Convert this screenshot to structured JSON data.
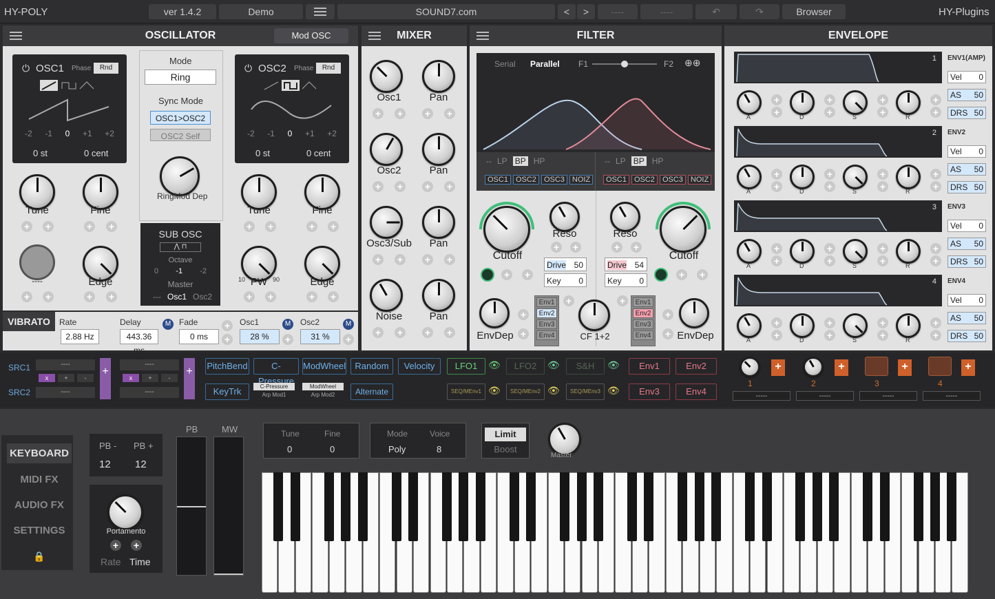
{
  "topbar": {
    "app_name": "HY-POLY",
    "version": "ver 1.4.2",
    "preset": "Demo",
    "site": "SOUND7.com",
    "prev": "<",
    "next": ">",
    "slot1": "----",
    "slot2": "----",
    "browser": "Browser",
    "brand": "HY-Plugins"
  },
  "oscillator": {
    "title": "OSCILLATOR",
    "mod_select": "Mod OSC",
    "osc1": {
      "name": "OSC1",
      "phase": "Phase",
      "rnd": "Rnd",
      "ticks": [
        "-2",
        "-1",
        "0",
        "+1",
        "+2"
      ],
      "semitone": "0 st",
      "cent": "0 cent"
    },
    "osc2": {
      "name": "OSC2",
      "phase": "Phase",
      "rnd": "Rnd",
      "ticks": [
        "-2",
        "-1",
        "0",
        "+1",
        "+2"
      ],
      "semitone": "0 st",
      "cent": "0 cent"
    },
    "mode_label": "Mode",
    "mode_value": "Ring",
    "sync_label": "Sync Mode",
    "sync_a": "OSC1>OSC2",
    "sync_b": "OSC2 Self",
    "ringmod": "RingMod Dep",
    "sub": {
      "title": "SUB OSC",
      "octave": "Octave",
      "oct_vals": [
        "0",
        "-1",
        "-2"
      ],
      "master": "Master",
      "m_vals": [
        "---",
        "Osc1",
        "Osc2"
      ]
    },
    "knobs": {
      "tune1": "Tune",
      "fine1": "Fine",
      "tune2": "Tune",
      "fine2": "Fine",
      "blank": "----",
      "edge1": "Edge",
      "pw": "PW",
      "pw_min": "10",
      "pw_max": "90",
      "edge2": "Edge"
    }
  },
  "vibrato": {
    "title": "VIBRATO",
    "rate_l": "Rate",
    "rate_v": "2.88 Hz",
    "delay_l": "Delay",
    "delay_v": "443.36 ms",
    "fade_l": "Fade",
    "fade_v": "0 ms",
    "osc1_l": "Osc1",
    "osc1_v": "28 %",
    "osc2_l": "Osc2",
    "osc2_v": "31 %",
    "m": "M"
  },
  "mixer": {
    "title": "MIXER",
    "rows": [
      {
        "src": "Osc1",
        "pan": "Pan"
      },
      {
        "src": "Osc2",
        "pan": "Pan"
      },
      {
        "src": "Osc3/Sub",
        "pan": "Pan"
      },
      {
        "src": "Noise",
        "pan": "Pan"
      }
    ]
  },
  "filter": {
    "title": "FILTER",
    "serial": "Serial",
    "parallel": "Parallel",
    "f1": "F1",
    "f2": "F2",
    "types": [
      "--",
      "LP",
      "BP",
      "HP"
    ],
    "srcs": [
      "OSC1",
      "OSC2",
      "OSC3",
      "NOIZ"
    ],
    "left": {
      "cutoff": "Cutoff",
      "reso": "Reso",
      "drive_l": "Drive",
      "drive_v": "50",
      "key_l": "Key",
      "key_v": "0",
      "envdep": "EnvDep"
    },
    "right": {
      "cutoff": "Cutoff",
      "reso": "Reso",
      "drive_l": "Drive",
      "drive_v": "54",
      "key_l": "Key",
      "key_v": "0",
      "envdep": "EnvDep"
    },
    "envs": [
      "Env1",
      "Env2",
      "Env3",
      "Env4"
    ],
    "cf": "CF 1+2"
  },
  "envelope": {
    "title": "ENVELOPE",
    "envs": [
      {
        "num": "1",
        "name": "ENV1(AMP)",
        "vel": "0",
        "as": "50",
        "drs": "50",
        "has_drs": true
      },
      {
        "num": "2",
        "name": "ENV2",
        "vel": "0",
        "as": "50",
        "drs": "50",
        "has_drs": true
      },
      {
        "num": "3",
        "name": "ENV3",
        "vel": "0",
        "as": "50",
        "drs": "50",
        "has_drs": true
      },
      {
        "num": "4",
        "name": "ENV4",
        "vel": "0",
        "as": "50",
        "drs": "50",
        "has_drs": true
      }
    ],
    "vel_l": "Vel",
    "as_l": "AS",
    "drs_l": "DRS",
    "adsr": [
      "A",
      "D",
      "S",
      "R"
    ]
  },
  "modmatrix": {
    "src1": "SRC1",
    "src2": "SRC2",
    "dash": "----",
    "ops": [
      "x",
      "+",
      "-"
    ],
    "btns_row1": [
      "PitchBend",
      "C-Pressure",
      "ModWheel",
      "Random",
      "Velocity"
    ],
    "keytrk": "KeyTrk",
    "small1": [
      "C-Pressure",
      "Arp Mod1"
    ],
    "small2": [
      "ModWheel",
      "Arp Mod2"
    ],
    "alternate": "Alternate",
    "lfo": [
      "LFO1",
      "LFO2",
      "S&H"
    ],
    "seq": [
      "SEQ/MEnv1",
      "SEQ/MEnv2",
      "SEQ/MEnv3"
    ],
    "envs": [
      "Env1",
      "Env2",
      "Env3",
      "Env4"
    ],
    "slots": [
      "1",
      "2",
      "3",
      "4"
    ],
    "slot_val": "-----"
  },
  "keyboard": {
    "side": [
      "KEYBOARD",
      "MIDI FX",
      "AUDIO FX",
      "SETTINGS"
    ],
    "pb_minus": "PB -",
    "pb_plus": "PB +",
    "pb_minus_v": "12",
    "pb_plus_v": "12",
    "portamento": "Portamento",
    "rate": "Rate",
    "time": "Time",
    "pb": "PB",
    "mw": "MW",
    "tune_l": "Tune",
    "tune_v": "0",
    "fine_l": "Fine",
    "fine_v": "0",
    "mode_l": "Mode",
    "mode_v": "Poly",
    "voice_l": "Voice",
    "voice_v": "8",
    "limit": "Limit",
    "boost": "Boost",
    "master": "Master"
  }
}
